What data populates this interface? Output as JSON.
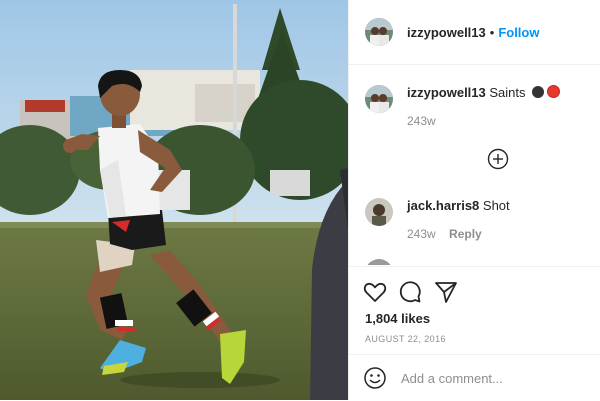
{
  "post": {
    "username": "izzypowell13",
    "follow_label": "Follow",
    "separator": "•"
  },
  "comments": [
    {
      "username": "izzypowell13",
      "text": "Saints",
      "badges": [
        "#333333",
        "#e8382c"
      ],
      "age": "243w"
    },
    {
      "username": "jack.harris8",
      "text": "Shot",
      "age": "243w",
      "reply_label": "Reply"
    }
  ],
  "icons": {
    "more": "plus-circle-icon",
    "like": "heart-icon",
    "comment": "speech-bubble-icon",
    "share": "paper-plane-icon",
    "emoji": "smiley-icon"
  },
  "stats": {
    "likes": "1,804 likes",
    "date": "AUGUST 22, 2016"
  },
  "add_comment": {
    "placeholder": "Add a comment..."
  }
}
